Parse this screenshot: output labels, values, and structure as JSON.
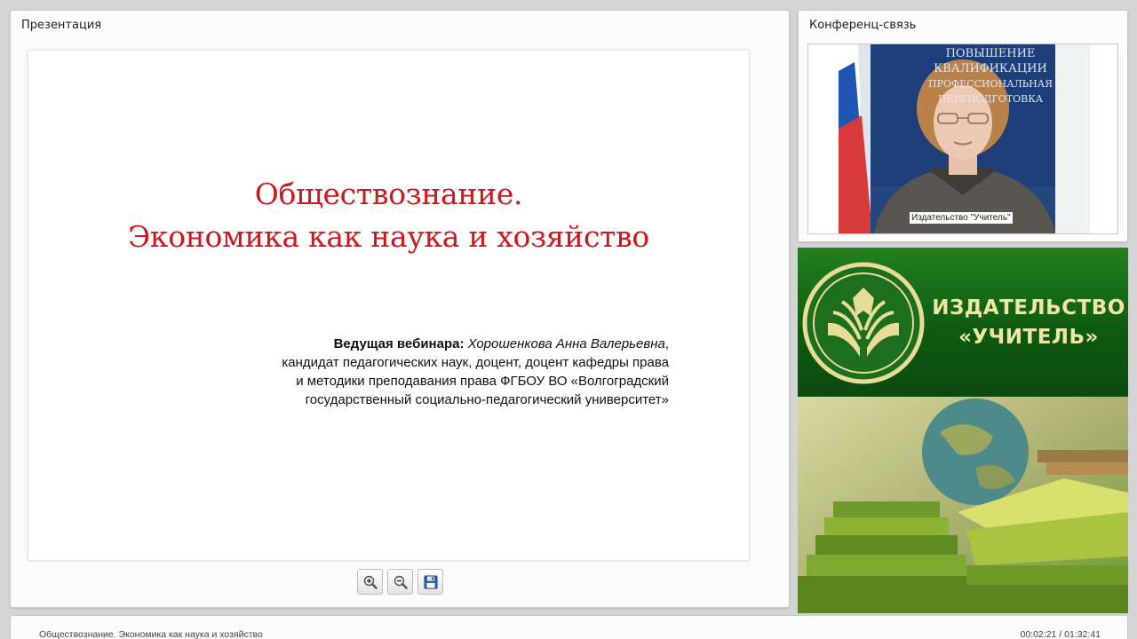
{
  "presentation": {
    "panel_title": "Презентация",
    "slide": {
      "title_line1": "Обществознание.",
      "title_line2": "Экономика как наука и хозяйство",
      "host_label": "Ведущая вебинара:",
      "host_name": "Хорошенкова Анна Валерьевна",
      "host_desc_line1": "кандидат педагогических наук, доцент, доцент кафедры права",
      "host_desc_line2": "и методики преподавания права ФГБОУ ВО «Волгоградский",
      "host_desc_line3": "государственный социально-педагогический университет»",
      "title_color": "#d0181c"
    },
    "toolbar": [
      {
        "icon": "zoom-in-icon"
      },
      {
        "icon": "zoom-out-icon"
      },
      {
        "icon": "save-icon"
      }
    ]
  },
  "conference": {
    "panel_title": "Конференц-связь",
    "participant_name": "Издательство \"Учитель\"",
    "banner_lines": [
      "ПОВЫШЕНИЕ",
      "КВАЛИФИКАЦИИ",
      "ПРОФЕССИОНАЛЬНАЯ",
      "ПЕРЕПОДГОТОВКА"
    ]
  },
  "brand": {
    "name_line1": "ИЗДАТЕЛЬСТВО",
    "name_line2": "«УЧИТЕЛЬ»",
    "primary_color": "#1a6e1a",
    "text_color": "#f0e6a2"
  },
  "status": {
    "title": "Обществознание. Экономика как наука и хозяйство",
    "time": "00:02:21 / 01:32:41"
  }
}
